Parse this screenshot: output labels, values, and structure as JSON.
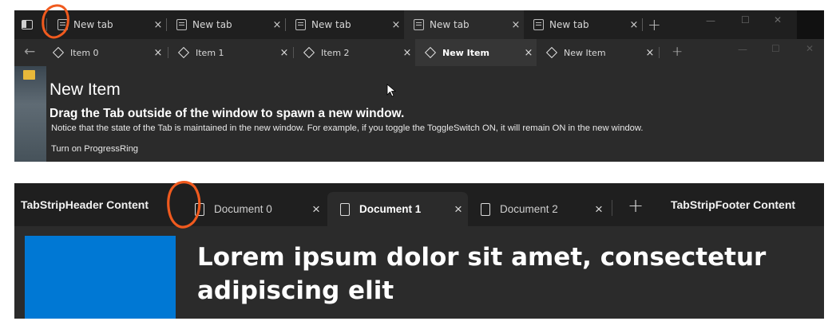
{
  "top_window": {
    "outer_tabs": [
      {
        "label": "New tab",
        "close": "×"
      },
      {
        "label": "New tab",
        "close": "×"
      },
      {
        "label": "New tab",
        "close": "×"
      },
      {
        "label": "New tab",
        "close": "×"
      },
      {
        "label": "New tab",
        "close": "×"
      }
    ],
    "outer_add": "+",
    "caption_buttons": {
      "minimize": "—",
      "maximize": "☐",
      "close": "✕"
    },
    "back_arrow": "←",
    "inner_tabs": [
      {
        "label": "Item 0",
        "close": "×"
      },
      {
        "label": "Item 1",
        "close": "×"
      },
      {
        "label": "Item 2",
        "close": "×"
      },
      {
        "label": "New Item",
        "close": "×"
      },
      {
        "label": "New Item",
        "close": "×"
      }
    ],
    "inner_add": "+",
    "content": {
      "title": "New Item",
      "subtitle": "Drag the Tab outside of the window to spawn a new window.",
      "note": "Notice that the state of the Tab is maintained in the new window. For example, if you toggle the ToggleSwitch ON, it will remain ON in the new window.",
      "progress_label": "Turn on ProgressRing"
    }
  },
  "bottom_window": {
    "header_content": "TabStripHeader Content",
    "footer_content": "TabStripFooter Content",
    "tabs": [
      {
        "label": "Document 0",
        "close": "×"
      },
      {
        "label": "Document 1",
        "close": "×"
      },
      {
        "label": "Document 2",
        "close": "×"
      }
    ],
    "add": "+",
    "heading": "Lorem ipsum dolor sit amet, consectetur adipiscing elit",
    "accent_color": "#0078d4"
  },
  "annotation_color": "#f05a1e"
}
